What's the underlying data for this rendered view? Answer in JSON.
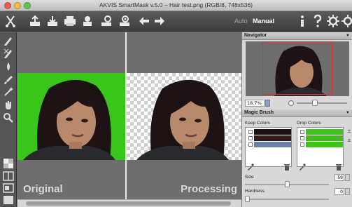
{
  "window": {
    "title": "AKVIS SmartMask v.5.0 – Hair test.png (RGB/8, 748x536)"
  },
  "toolbar": {
    "icons": [
      "scissors-logo-icon",
      "open-icon",
      "save-icon",
      "print-icon",
      "plugin-icon",
      "settings-cog-icon",
      "batch-icon",
      "undo-arrow-icon",
      "redo-arrow-icon"
    ],
    "mode_auto": "Auto",
    "mode_manual": "Manual",
    "right_icons": [
      "info-icon",
      "help-icon",
      "preferences-icon",
      "plugins-icon"
    ]
  },
  "canvas": {
    "left_label": "Original",
    "right_label": "Processing",
    "background_left": "#3ac51a"
  },
  "navigator": {
    "title": "Navigator",
    "zoom_value": "18.7%"
  },
  "magic_brush": {
    "title": "Magic Brush",
    "keep_colors_label": "Keep Colors",
    "drop_colors_label": "Drop Colors",
    "keep_swatches": [
      "#1a1012",
      "#2c1a1d",
      "#6b7ea6"
    ],
    "drop_swatches": [
      "#41c41f",
      "#3fbc1c",
      "#3ac51a"
    ],
    "size_label": "Size",
    "size_value": "59",
    "size_level": 0.5,
    "hardness_label": "Hardness",
    "hardness_value": "0",
    "hardness_level": 0.0
  },
  "colors": {
    "accent_green": "#3ac51a",
    "selection_blue": "#6b7ea6",
    "navigator_frame": "#e0302b"
  }
}
